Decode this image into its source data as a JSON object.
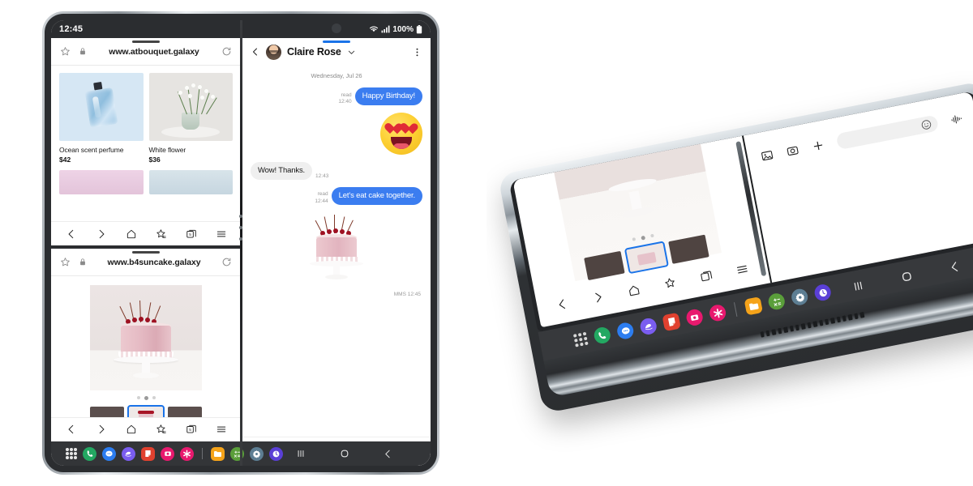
{
  "device_left": {
    "status_bar": {
      "time": "12:45",
      "battery_text": "100%",
      "icons": [
        "wifi-icon",
        "signal-icon",
        "battery-icon"
      ]
    },
    "browser_top": {
      "url": "www.atbouquet.galaxy",
      "icons": {
        "bookmark": "star-icon",
        "lock": "lock-icon",
        "reload": "reload-icon"
      },
      "products": [
        {
          "title": "Ocean scent perfume",
          "price": "$42",
          "image": "perfume-bottle"
        },
        {
          "title": "White flower",
          "price": "$36",
          "image": "flower-vase"
        }
      ],
      "swatches": [
        "#e7cfe0",
        "#cfdde6"
      ]
    },
    "browser_bottom": {
      "url": "www.b4suncake.galaxy",
      "icons": {
        "bookmark": "star-icon",
        "lock": "lock-icon",
        "reload": "reload-icon"
      },
      "carousel_dots": 3,
      "carousel_active": 1,
      "thumbnails": 3,
      "thumbnail_selected": 1
    },
    "browser_nav": {
      "back": "back-icon",
      "forward": "forward-icon",
      "home": "home-icon",
      "bookmarks": "bookmarks-star-icon",
      "tabs": "tabs-icon",
      "tab_count": "5",
      "menu": "menu-icon"
    },
    "messages": {
      "contact_name": "Claire Rose",
      "back": "back-icon",
      "dropdown": "chevron-down-icon",
      "more": "more-vertical-icon",
      "day_stamp": "Wednesday, Jul 26",
      "bubbles": [
        {
          "side": "out",
          "text": "Happy Birthday!",
          "status": "read",
          "time": "12:40",
          "kind": "text"
        },
        {
          "side": "out",
          "kind": "emoji",
          "emoji": "heart-eyes-emoji"
        },
        {
          "side": "in",
          "text": "Wow! Thanks.",
          "time": "12:43",
          "kind": "text"
        },
        {
          "side": "out",
          "text": "Let's eat cake together.",
          "status": "read",
          "time": "12:44",
          "kind": "text"
        },
        {
          "side": "out",
          "kind": "image",
          "image": "cherry-cake-photo",
          "label": "MMS 12:45"
        }
      ],
      "composer": {
        "gallery": "gallery-icon",
        "camera": "camera-icon",
        "add": "plus-icon",
        "placeholder": "",
        "emoji": "emoji-smiley-icon",
        "voice": "voice-waveform-icon"
      }
    },
    "taskbar": {
      "apps_button": "apps-grid-icon",
      "apps": [
        {
          "name": "phone-app",
          "color": "#23a862",
          "glyph": "phone-icon"
        },
        {
          "name": "messages-app",
          "color": "#2c7df0",
          "glyph": "chat-icon"
        },
        {
          "name": "browser-app",
          "color": "#7a5df0",
          "glyph": "browser-icon"
        },
        {
          "name": "notes-app",
          "color": "#e0412f",
          "glyph": "note-icon"
        },
        {
          "name": "camera-app",
          "color": "#e8196e",
          "glyph": "camera-icon"
        },
        {
          "name": "gallery-app",
          "color": "#e8196e",
          "glyph": "asterisk-icon"
        },
        {
          "name": "files-app",
          "color": "#f5a31a",
          "glyph": "folder-icon"
        },
        {
          "name": "calculator-app",
          "color": "#5a9e3a",
          "glyph": "calculator-icon"
        },
        {
          "name": "settings-app",
          "color": "#5d7e93",
          "glyph": "gear-icon"
        },
        {
          "name": "clock-app",
          "color": "#5a3fd6",
          "glyph": "clock-icon"
        }
      ],
      "nav": {
        "recents": "recents-icon",
        "home": "home-circle-icon",
        "back": "back-chevron-icon"
      }
    }
  },
  "device_right": {
    "description": "product-photo-foldable-with-stylus",
    "stylus": "s-pen-stylus",
    "browser_nav": {
      "back": "back-icon",
      "forward": "forward-icon",
      "home": "home-icon",
      "bookmarks": "bookmarks-star-icon",
      "tabs": "tabs-icon",
      "menu": "menu-icon"
    },
    "composer": {
      "gallery": "gallery-icon",
      "camera": "camera-icon",
      "add": "plus-icon",
      "emoji": "emoji-smiley-icon",
      "voice": "voice-waveform-icon"
    },
    "taskbar": {
      "apps_button": "apps-grid-icon",
      "apps": [
        {
          "name": "phone-app",
          "color": "#23a862"
        },
        {
          "name": "messages-app",
          "color": "#2c7df0"
        },
        {
          "name": "browser-app",
          "color": "#7a5df0"
        },
        {
          "name": "notes-app",
          "color": "#e0412f"
        },
        {
          "name": "camera-app",
          "color": "#e8196e"
        },
        {
          "name": "gallery-app",
          "color": "#e8196e"
        },
        {
          "name": "files-app",
          "color": "#f5a31a"
        },
        {
          "name": "calculator-app",
          "color": "#5a9e3a"
        },
        {
          "name": "settings-app",
          "color": "#5d7e93"
        },
        {
          "name": "clock-app",
          "color": "#5a3fd6"
        }
      ],
      "nav": {
        "recents": "recents-icon",
        "home": "home-circle-icon",
        "back": "back-chevron-icon"
      }
    }
  },
  "colors": {
    "accent_blue": "#3b7df0",
    "tab_indicator": "#1a73e8",
    "incoming_bubble": "#efefef",
    "taskbar": "#333538",
    "frame_dark": "#2b2d30"
  }
}
